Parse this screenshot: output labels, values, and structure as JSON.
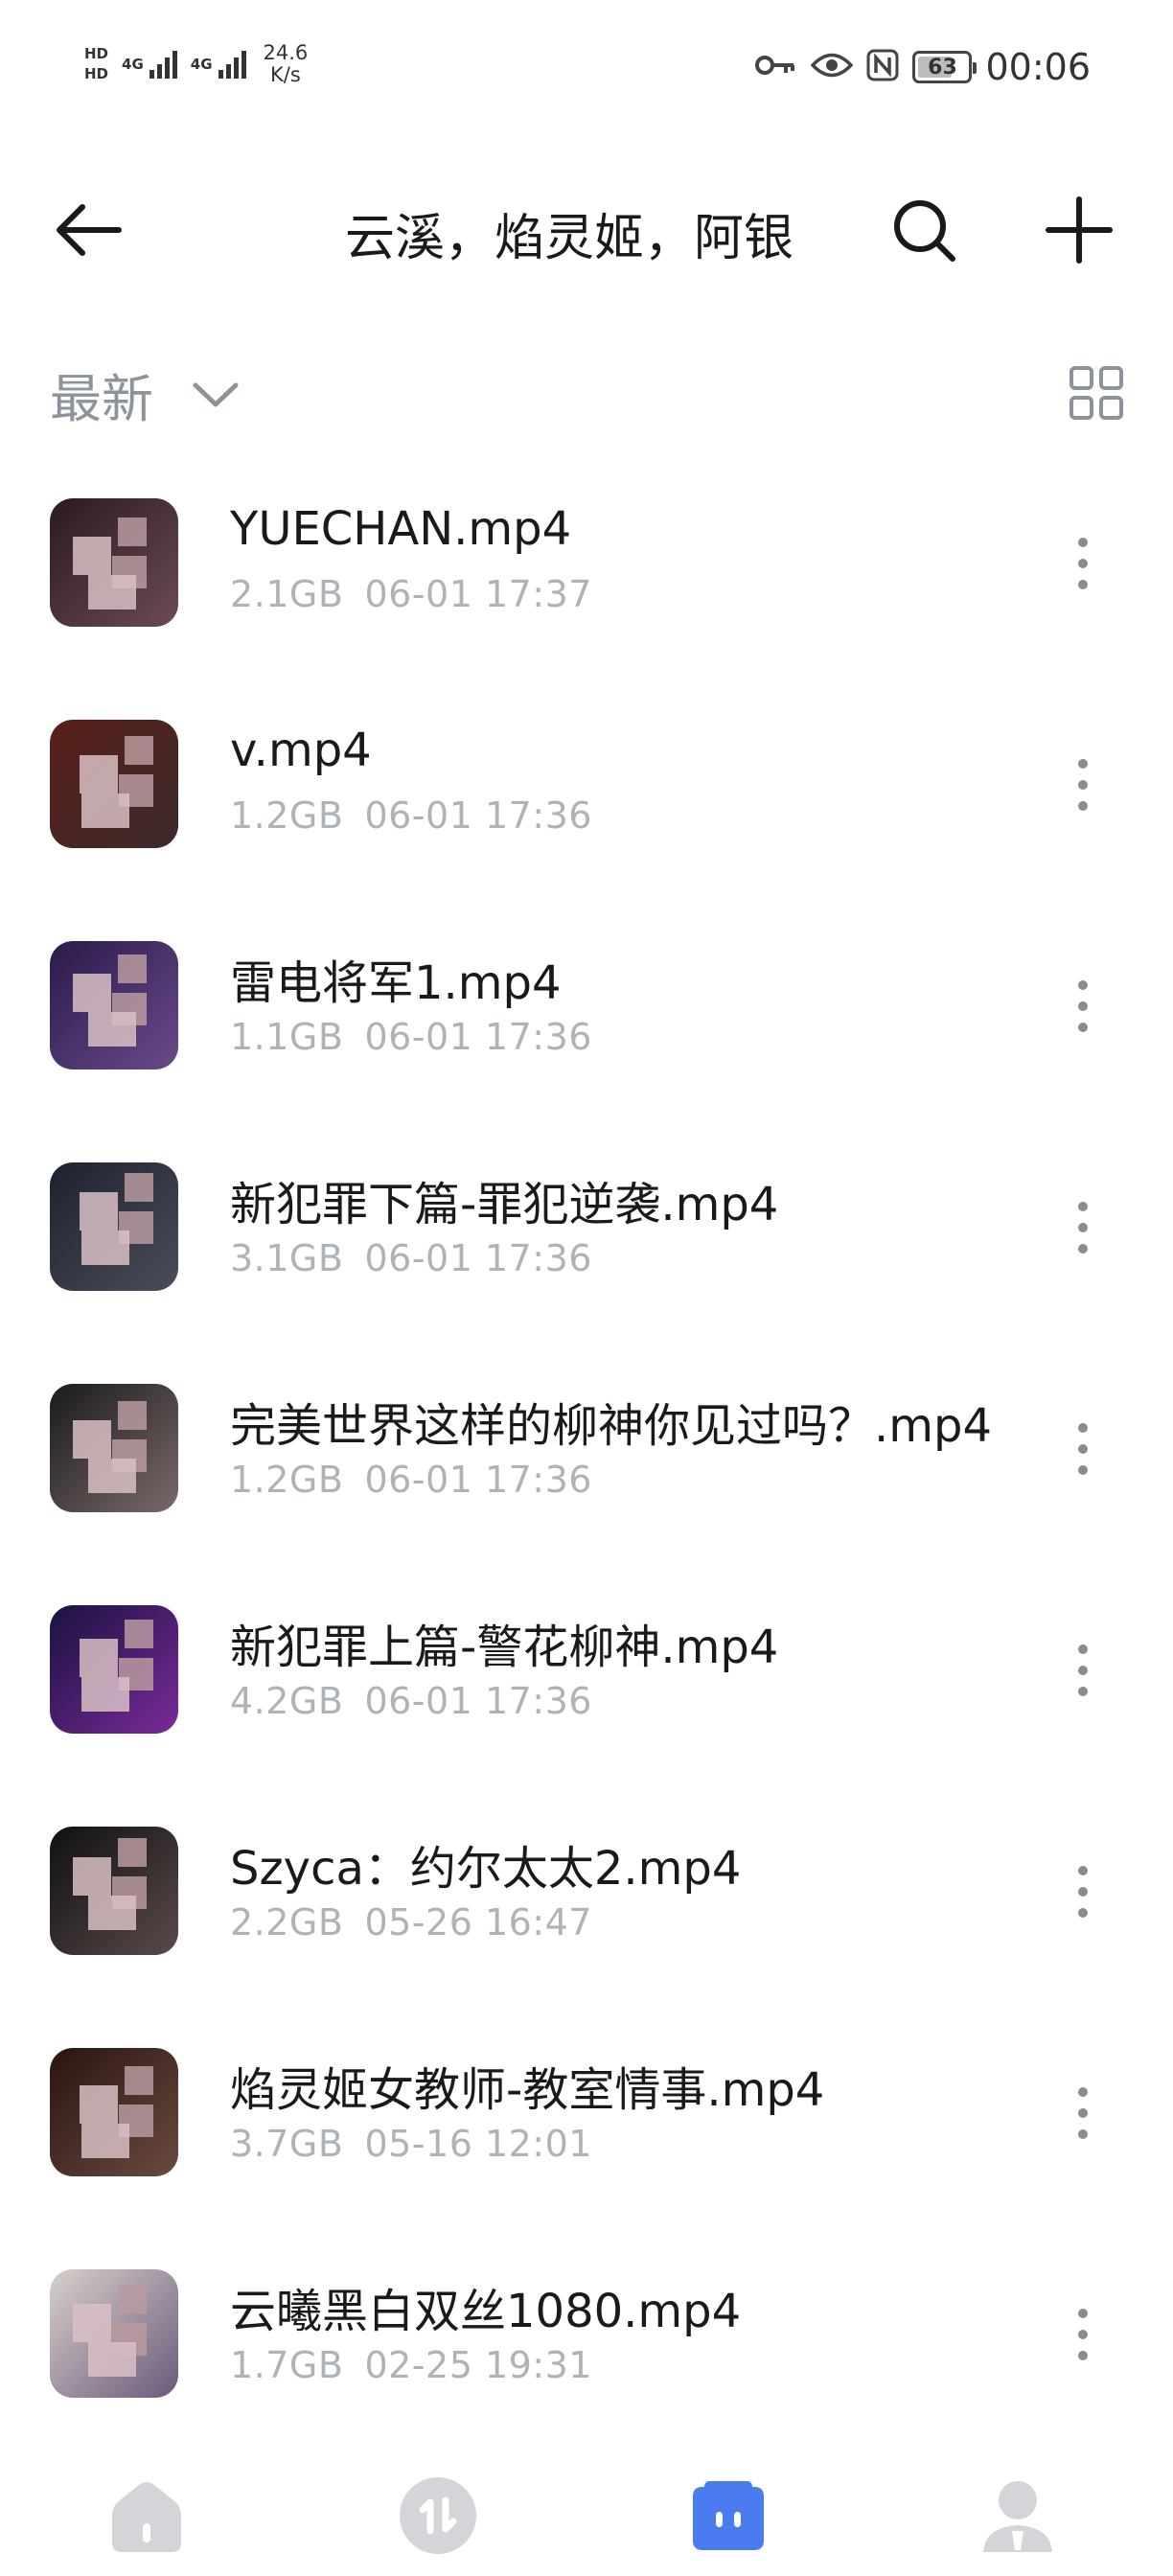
{
  "status_bar": {
    "hd_top": "HD",
    "hd_bottom": "HD",
    "network1": "4G",
    "network2": "4G",
    "speed_value": "24.6",
    "speed_unit": "K/s",
    "battery": "63",
    "time": "00:06",
    "icons": [
      "key-icon",
      "eye-icon",
      "nfc-icon",
      "battery-icon"
    ]
  },
  "header": {
    "title": "云溪，焰灵姬，阿银",
    "back_icon": "arrow-left-icon",
    "search_icon": "search-icon",
    "add_icon": "plus-icon"
  },
  "sort": {
    "label": "最新",
    "chevron_icon": "chevron-down-icon",
    "view_icon": "grid-view-icon"
  },
  "files": [
    {
      "name": "YUECHAN.mp4",
      "size": "2.1GB",
      "date": "06-01 17:37",
      "thumb_colors": [
        "#2b1a20",
        "#6b4b55"
      ]
    },
    {
      "name": "v.mp4",
      "size": "1.2GB",
      "date": "06-01 17:36",
      "thumb_colors": [
        "#5a1f1a",
        "#3a2a2a"
      ]
    },
    {
      "name": "雷电将军1.mp4",
      "size": "1.1GB",
      "date": "06-01 17:36",
      "thumb_colors": [
        "#2a1a4a",
        "#6a4a8a"
      ]
    },
    {
      "name": "新犯罪下篇-罪犯逆袭.mp4",
      "size": "3.1GB",
      "date": "06-01 17:36",
      "thumb_colors": [
        "#1e2230",
        "#4a4e5a"
      ]
    },
    {
      "name": "完美世界这样的柳神你见过吗？.mp4",
      "size": "1.2GB",
      "date": "06-01 17:36",
      "thumb_colors": [
        "#1a1a1a",
        "#7a6a6a"
      ]
    },
    {
      "name": "新犯罪上篇-警花柳神.mp4",
      "size": "4.2GB",
      "date": "06-01 17:36",
      "thumb_colors": [
        "#1a1240",
        "#7a2a9a"
      ]
    },
    {
      "name": "Szyca：约尔太太2.mp4",
      "size": "2.2GB",
      "date": "05-26 16:47",
      "thumb_colors": [
        "#101010",
        "#5a4a4a"
      ]
    },
    {
      "name": "焰灵姬女教师-教室情事.mp4",
      "size": "3.7GB",
      "date": "05-16 12:01",
      "thumb_colors": [
        "#2a1410",
        "#6a4a40"
      ]
    },
    {
      "name": "云曦黑白双丝1080.mp4",
      "size": "1.7GB",
      "date": "02-25 19:31",
      "thumb_colors": [
        "#d8d0cc",
        "#6a5a7a"
      ]
    }
  ],
  "bottom_nav": {
    "items": [
      {
        "icon": "home-icon",
        "active": false
      },
      {
        "icon": "transfer-icon",
        "active": false
      },
      {
        "icon": "files-icon",
        "active": true
      },
      {
        "icon": "profile-icon",
        "active": false
      }
    ],
    "active_color": "#4a7cf0",
    "inactive_color": "#d3d5d8"
  }
}
